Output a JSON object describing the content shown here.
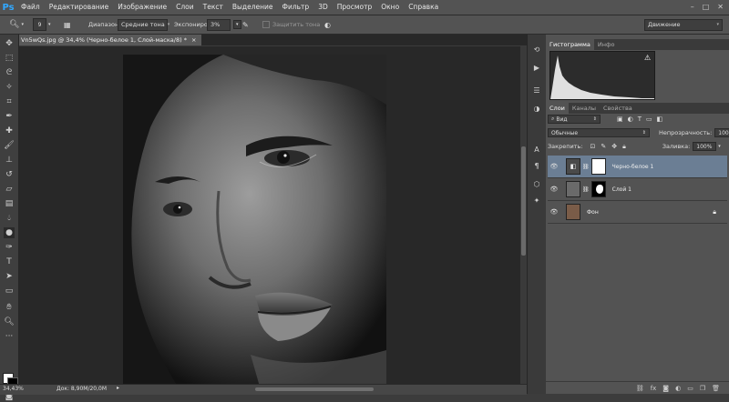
{
  "app": {
    "logo": "Ps",
    "menu": [
      "Файл",
      "Редактирование",
      "Изображение",
      "Слои",
      "Текст",
      "Выделение",
      "Фильтр",
      "3D",
      "Просмотр",
      "Окно",
      "Справка"
    ],
    "window_controls": [
      "–",
      "□",
      "✕"
    ]
  },
  "options_bar": {
    "brush_size": "9",
    "range_label": "Диапазон:",
    "range_value": "Средние тона",
    "exposure_label": "Экспониро...:",
    "exposure_value": "3%",
    "protect_tones_label": "Защитить тона",
    "workspace": "Движение"
  },
  "document": {
    "tab_title": "Vn5wQs.jpg @ 34,4% (Черно-белое 1, Слой-маска/8) *",
    "close": "×"
  },
  "status": {
    "zoom": "34,43%",
    "doc_size": "Док: 8,90M/20,0M"
  },
  "panels": {
    "histogram_tabs": [
      "Гистограмма",
      "Инфо"
    ],
    "layers_tabs": [
      "Слои",
      "Каналы",
      "Свойства"
    ],
    "kind_filter": "Вид",
    "blend_mode": "Обычные",
    "opacity_label": "Непрозрачность:",
    "opacity_value": "100%",
    "lock_label": "Закрепить:",
    "fill_label": "Заливка:",
    "fill_value": "100%",
    "layers": [
      {
        "name": "Черно-белое 1",
        "selected": true
      },
      {
        "name": "Слой 1",
        "selected": false
      },
      {
        "name": "Фон",
        "selected": false
      }
    ]
  },
  "colors": {
    "accent": "#31a8ff",
    "selected_layer": "#6b7e94"
  }
}
